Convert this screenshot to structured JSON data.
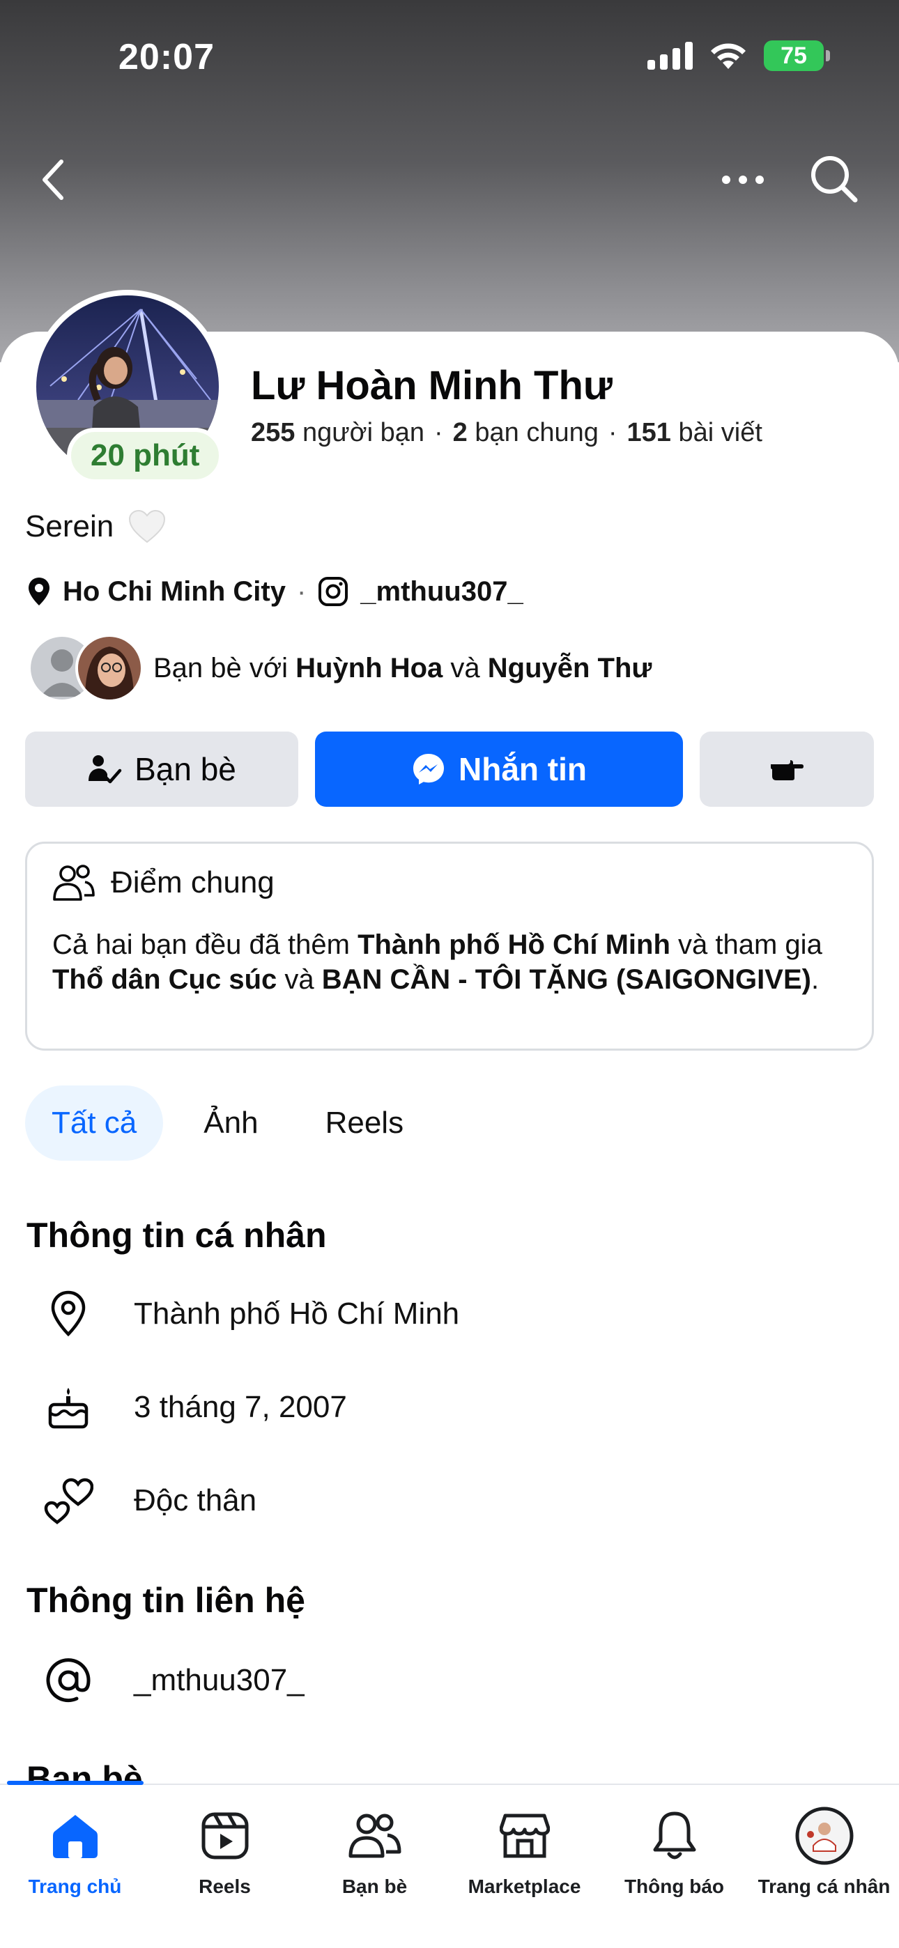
{
  "status_bar": {
    "time": "20:07",
    "battery": "75"
  },
  "profile": {
    "name": "Lư Hoàn Minh Thư",
    "active_badge": "20 phút",
    "stats": {
      "friends_count": "255",
      "friends_label": "người bạn",
      "mutual_count": "2",
      "mutual_label": "bạn chung",
      "posts_count": "151",
      "posts_label": "bài viết"
    },
    "bio": "Serein",
    "location": "Ho Chi Minh City",
    "instagram": "_mthuu307_",
    "mutual_friends": {
      "prefix": "Bạn bè với",
      "friend1": "Huỳnh Hoa",
      "conjunction": "và",
      "friend2": "Nguyễn Thư"
    }
  },
  "actions": {
    "friends_label": "Bạn bè",
    "message_label": "Nhắn tin"
  },
  "common": {
    "title": "Điểm chung",
    "text_part1": "Cả hai bạn đều đã thêm",
    "city": "Thành phố Hồ Chí Minh",
    "text_part2": "và tham gia",
    "group1": "Thổ dân Cục súc",
    "text_part3": "và",
    "group2": "BẠN CẦN - TÔI TẶNG (SAIGONGIVE)",
    "text_end": "."
  },
  "tabs": [
    {
      "label": "Tất cả",
      "active": true
    },
    {
      "label": "Ảnh",
      "active": false
    },
    {
      "label": "Reels",
      "active": false
    }
  ],
  "personal_info": {
    "title": "Thông tin cá nhân",
    "city": "Thành phố Hồ Chí Minh",
    "birthday": "3 tháng 7, 2007",
    "relationship": "Độc thân"
  },
  "contact_info": {
    "title": "Thông tin liên hệ",
    "instagram": "_mthuu307_"
  },
  "friends_section": {
    "title": "Bạn bè"
  },
  "bottom_nav": [
    {
      "label": "Trang chủ",
      "icon": "home-icon",
      "active": true
    },
    {
      "label": "Reels",
      "icon": "reels-icon",
      "active": false
    },
    {
      "label": "Bạn bè",
      "icon": "friends-icon",
      "active": false
    },
    {
      "label": "Marketplace",
      "icon": "marketplace-icon",
      "active": false
    },
    {
      "label": "Thông báo",
      "icon": "bell-icon",
      "active": false
    },
    {
      "label": "Trang cá nhân",
      "icon": "profile-avatar-icon",
      "active": false
    }
  ],
  "colors": {
    "accent": "#0866ff",
    "active_green": "#2e7d32",
    "button_gray": "#e4e6eb"
  }
}
